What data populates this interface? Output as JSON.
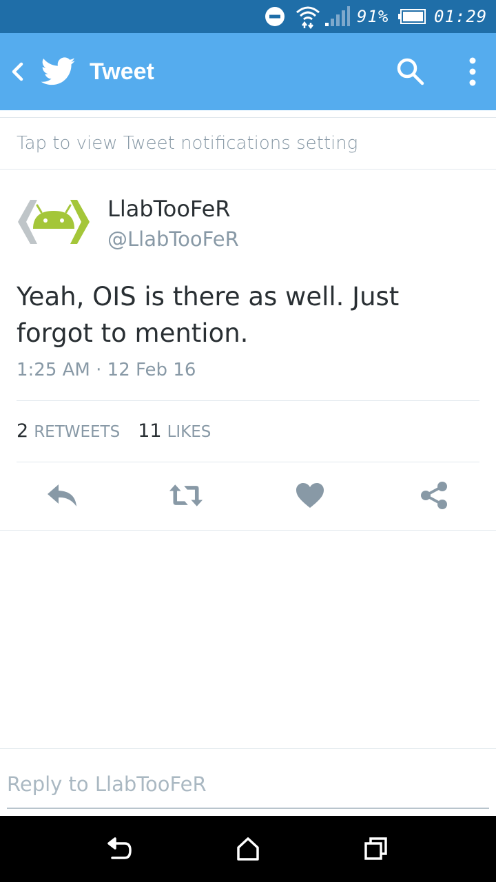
{
  "status_bar": {
    "battery_percent": "91%",
    "time": "01:29",
    "icons": [
      "do-not-disturb-icon",
      "wifi-icon",
      "signal-icon",
      "battery-icon"
    ]
  },
  "app_bar": {
    "title": "Tweet",
    "icons": [
      "back-icon",
      "twitter-bird-icon",
      "search-icon",
      "more-vertical-icon"
    ]
  },
  "notification_banner": {
    "text": "Tap to view Tweet notifications setting"
  },
  "tweet": {
    "display_name": "LlabTooFeR",
    "handle": "@LlabTooFeR",
    "text": "Yeah, OIS is there as well. Just forgot to mention.",
    "timestamp": "1:25 AM · 12 Feb 16",
    "stats": {
      "retweets_count": "2",
      "retweets_label": "RETWEETS",
      "likes_count": "11",
      "likes_label": "LIKES"
    },
    "actions": [
      "reply-icon",
      "retweet-icon",
      "like-icon",
      "share-icon"
    ]
  },
  "reply_bar": {
    "placeholder": "Reply to LlabTooFeR"
  },
  "nav_bar": {
    "icons": [
      "nav-back-icon",
      "nav-home-icon",
      "nav-recents-icon"
    ]
  },
  "colors": {
    "status_bar": "#1f6ea8",
    "app_bar": "#55acee",
    "action_icon": "#8899a6",
    "secondary_text": "#8899a6",
    "primary_text": "#292f33",
    "avatar_green": "#a4c639",
    "avatar_gray": "#bfc5c8"
  }
}
